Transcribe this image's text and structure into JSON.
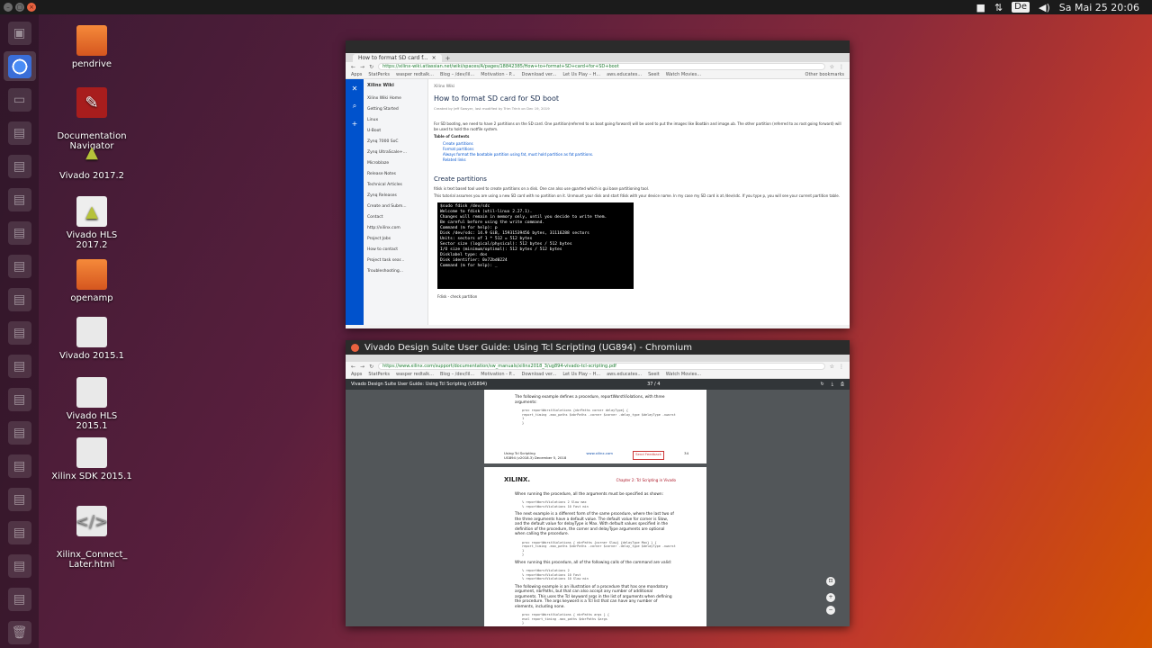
{
  "topbar": {
    "datetime": "Sa Mai 25 20:06",
    "keyboard_layout": "De"
  },
  "launcher": {
    "items": [
      "files",
      "chrome",
      "terminal",
      "app",
      "app",
      "app",
      "app",
      "app",
      "app",
      "app",
      "app",
      "app",
      "app",
      "app",
      "app",
      "app",
      "app",
      "app",
      "trash"
    ]
  },
  "desktop": {
    "icons": [
      {
        "label": "pendrive",
        "type": "folder"
      },
      {
        "label": "Documentation\nNavigator",
        "type": "xlsx"
      },
      {
        "label": "Vivado 2017.2",
        "type": "vivado"
      },
      {
        "label": "Vivado HLS 2017.2",
        "type": "vivado"
      },
      {
        "label": "openamp",
        "type": "folder"
      },
      {
        "label": "Vivado 2015.1",
        "type": "doc"
      },
      {
        "label": "Vivado HLS 2015.1",
        "type": "doc"
      },
      {
        "label": "Xilinx SDK 2015.1",
        "type": "doc"
      },
      {
        "label": "Xilinx_Connect_\nLater.html",
        "type": "doc"
      }
    ]
  },
  "window1": {
    "tab_title": "How to format SD card f...",
    "url": "https://xilinx-wiki.atlassian.net/wiki/spaces/A/pages/18842385/How+to+format+SD+card+for+SD+boot",
    "bookmarks": [
      "Apps",
      "StatPerks",
      "wasper redtalk...",
      "Blog – /dev/lil...",
      "Motivation - P...",
      "Download ver...",
      "Let Us Play – H...",
      "aws.educates...",
      "Seeit",
      "Watch Movies...",
      "Other bookmarks"
    ],
    "rail_icons": [
      "atlassian-icon",
      "search-icon",
      "plus-icon"
    ],
    "sidebar": {
      "space": "Xilinx Wiki",
      "items": [
        "Xilinx Wiki Home",
        "Getting Started",
        "Linux",
        "U-Boot",
        "Zynq 7000 SoC",
        "Zynq UltraScale+...",
        "Microblaze",
        "Release Notes",
        "Technical Articles",
        "Zynq Releases",
        "Create and Subm...",
        "Contact",
        "http://xilinx.com",
        "Project Jobs",
        "How to contact",
        "Project task sear...",
        "Troubleshooting..."
      ]
    },
    "breadcrumb": "Xilinx Wiki",
    "title": "How to format SD card for SD boot",
    "meta": "Created by Jeff Sawyer, last modified by Trim Trinh on Dec 19, 2019",
    "intro": "For SD booting, we need to have 2 partitions on the SD card. One partition(referred to as boot going forward) will be used to put the images like Bootbin and image.ub. The other partition (referred to as root going forward) will be used to hold the rootfile system.",
    "toc_title": "Table of Contents",
    "toc": [
      "Create partitions",
      "Format partitions",
      "Always format the bootable partition using fat, must hold partition as fat partitions.",
      "Related links"
    ],
    "section_title": "Create partitions",
    "section_p1": "fdisk is text based tool used to create partitions on a disk. One can also use gparted which is gui base partitioning tool.",
    "section_p2": "This tutorial assumes you are using a new SD card with no partition on it. Unmount your disk and start fdisk with your device name. In my case my SD card is at /dev/sdc. If you type p, you will see your current partition table.",
    "terminal": [
      "$sudo fdisk /dev/sdc",
      "",
      "Welcome to fdisk (util-linux 2.27.1).",
      "Changes will remain in memory only, until you decide to write them.",
      "Be careful before using the write command.",
      "",
      "",
      "Command (m for help): p",
      "Disk /dev/sdc: 14.9 GiB, 15931539456 bytes, 31116288 sectors",
      "Units: sectors of 1 * 512 = 512 bytes",
      "Sector size (logical/physical): 512 bytes / 512 bytes",
      "I/O size (minimum/optimal): 512 bytes / 512 bytes",
      "Disklabel type: dos",
      "Disk identifier: 0x72bd0224",
      "",
      "Command (m for help): _"
    ],
    "terminal_caption": "Fdisk - check partition"
  },
  "window2": {
    "title": "Vivado Design Suite User Guide: Using Tcl Scripting (UG894) - Chromium",
    "url": "https://www.xilinx.com/support/documentation/sw_manuals/xilinx2018_3/ug894-vivado-tcl-scripting.pdf",
    "pdf_title": "Vivado Design Suite User Guide: Using Tcl Scripting (UG894)",
    "page_counter": "37 / 4",
    "page1": {
      "text": "The following example defines a procedure, reportWorstViolations, with three arguments:",
      "code": [
        "proc reportWorstViolations {nbrPaths corner delayType} {",
        "report_timing -max_paths $nbrPaths -corner $corner -delay_type $delayType -nworst 1",
        "}"
      ],
      "footer_left": "Using Tcl Scripting",
      "footer_left2": "UG894 (v2018.3) December 5, 2018",
      "footer_mid": "www.xilinx.com",
      "feedback": "Send Feedback",
      "page_no": "34"
    },
    "page2": {
      "logo": "XILINX.",
      "chapter": "Chapter 2: Tcl Scripting in Vivado",
      "p1": "When running the procedure, all the arguments must be specified as shown:",
      "code1": [
        "% reportWorstViolations 2 Slow max",
        "% reportWorstViolations 10 Fast min"
      ],
      "p2": "The next example is a different form of the same procedure, where the last two of the three arguments have a default value. The default value for corner is Slow, and the default value for delayType is Max. With default values specified in the definition of the procedure, the corner and delayType arguments are optional when calling the procedure.",
      "code2": [
        "proc reportWorstViolations { nbrPaths {corner Slow} {delayType Max} } {",
        "report_timing -max_paths $nbrPaths -corner $corner -delay_type $delayType -nworst 1",
        "}"
      ],
      "p3": "When running this procedure, all of the following calls of the command are valid:",
      "code3": [
        "% reportWorstViolations 2",
        "% reportWorstViolations 10 Fast",
        "% reportWorstViolations 10 Slow min"
      ],
      "p4": "The following example is an illustration of a procedure that has one mandatory argument, nbrPaths, but that can also accept any number of additional arguments. This uses the Tcl keyword args in the list of arguments when defining the procedure. The args keyword is a Tcl list that can have any number of elements, including none.",
      "code4": [
        "proc reportWorstViolations { nbrPaths args } {",
        "eval report_timing -max_paths $nbrPaths $args",
        "}"
      ]
    }
  }
}
